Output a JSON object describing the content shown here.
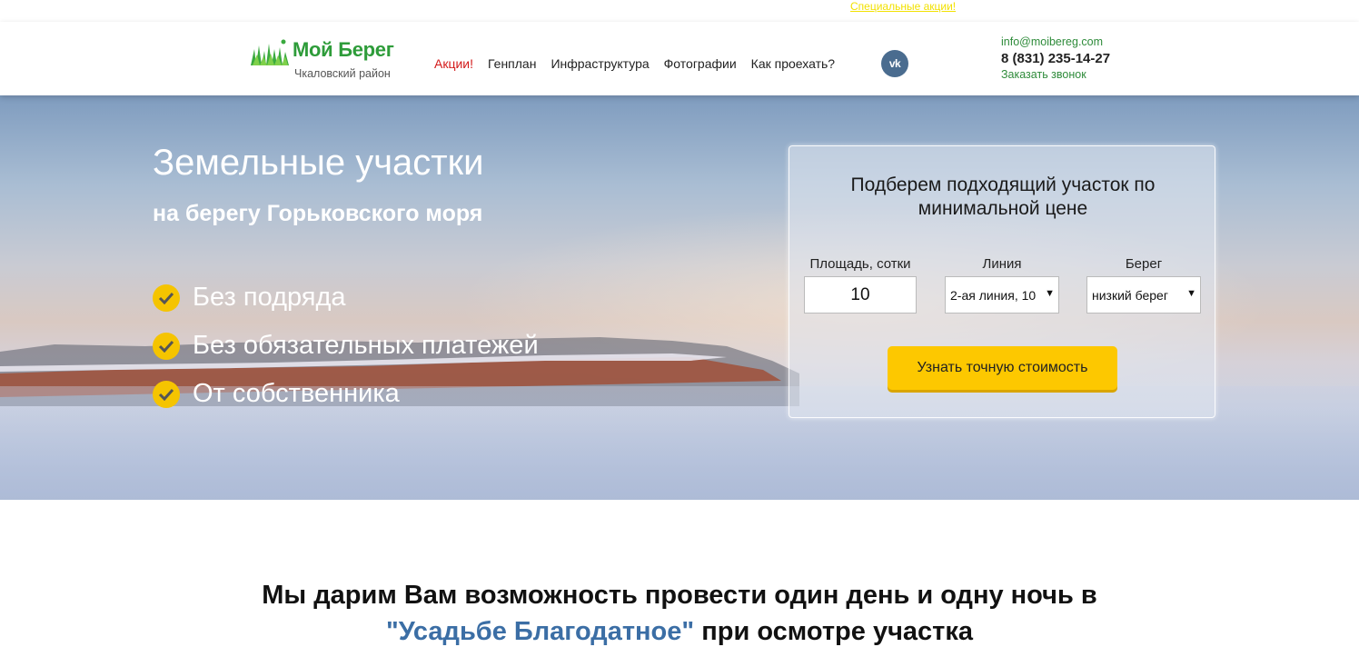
{
  "promo": {
    "link": "Специальные акции!"
  },
  "logo": {
    "title": "Мой Берег",
    "subtitle": "Чкаловский район"
  },
  "nav": [
    {
      "label": "Акции!",
      "accent": true
    },
    {
      "label": "Генплан"
    },
    {
      "label": "Инфраструктура"
    },
    {
      "label": "Фотографии"
    },
    {
      "label": "Как проехать?"
    }
  ],
  "social": {
    "vk": "vk"
  },
  "contacts": {
    "email": "info@moibereg.com",
    "phone": "8 (831) 235-14-27",
    "callback": "Заказать звонок"
  },
  "hero": {
    "title": "Земельные участки",
    "subtitle": "на берегу Горьковского моря",
    "benefits": [
      "Без подряда",
      "Без обязательных платежей",
      "От собственника"
    ]
  },
  "form": {
    "title": "Подберем подходящий участок по минимальной цене",
    "area_label": "Площадь, сотки",
    "area_value": "10",
    "line_label": "Линия",
    "line_value": "2-ая линия, 10",
    "shore_label": "Берег",
    "shore_value": "низкий берег",
    "submit": "Узнать точную стоимость"
  },
  "gift": {
    "line1": "Мы дарим Вам возможность провести один день и одну ночь в",
    "highlight": "\"Усадьбе Благодатное\"",
    "rest": " при осмотре участка"
  },
  "colors": {
    "accent_green": "#2e9c3a",
    "button_yellow": "#fdc800",
    "nav_red": "#d31a1a",
    "link_blue": "#3b6ea5"
  }
}
